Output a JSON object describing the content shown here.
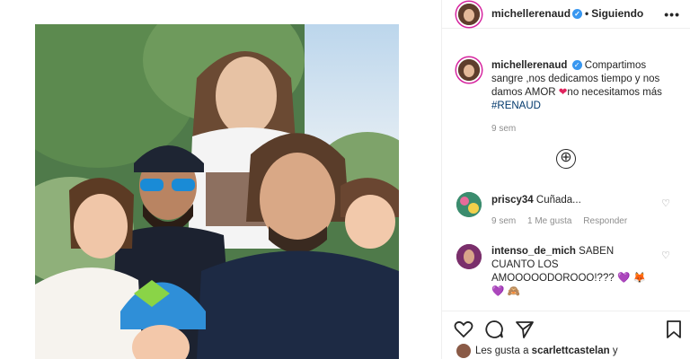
{
  "header": {
    "username": "michellerenaud",
    "verified_mark": "✓",
    "separator": "•",
    "follow_status": "Siguiendo",
    "more": "•••"
  },
  "caption": {
    "username": "michellerenaud",
    "verified_mark": "✓",
    "text": "Compartimos sangre ,nos dedicamos tiempo y nos damos AMOR",
    "emoji": "❤",
    "text_after": "no necesitamos más",
    "hashtag": "#RENAUD",
    "time": "9 sem"
  },
  "load_more_icon": "⊕",
  "comments": [
    {
      "username": "priscy34",
      "text": "Cuñada...",
      "time": "9 sem",
      "likes": "1 Me gusta",
      "reply": "Responder"
    },
    {
      "username": "intenso_de_mich",
      "text": "SABEN CUANTO LOS AMOOOOODOROOO!???",
      "emoji_end": "💜 🦊",
      "emoji_line2": "💜 🙈"
    }
  ],
  "likes_line": {
    "prefix": "Les gusta a",
    "username": "scarlettcastelan",
    "suffix": "y"
  },
  "colors": {
    "verified": "#3897f0",
    "hashtag": "#00376b",
    "meta": "#8e8e8e",
    "story_ring": "#d6249f"
  },
  "icons": {
    "like": "heart-outline-icon",
    "comment": "comment-bubble-icon",
    "share": "paper-plane-icon",
    "save": "bookmark-icon",
    "more": "ellipsis-icon"
  }
}
